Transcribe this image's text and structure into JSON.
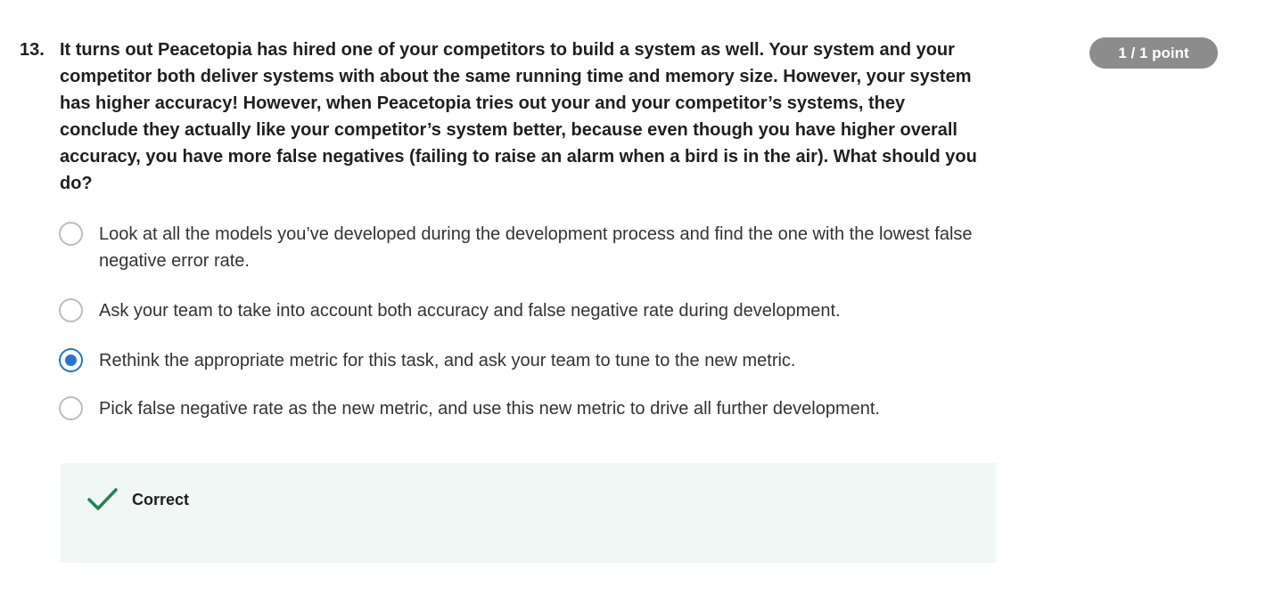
{
  "question": {
    "number": "13.",
    "text": "It turns out Peacetopia has hired one of your competitors to build a system as well. Your system and your competitor both deliver systems with about the same running time and memory size. However, your system has higher accuracy! However, when Peacetopia tries out your and your competitor’s systems, they conclude they actually like your competitor’s system better, because even though you have higher overall accuracy, you have more false negatives (failing to raise an alarm when a bird is in the air). What should you do?",
    "points": "1 / 1 point"
  },
  "options": [
    {
      "label": "Look at all the models you’ve developed during the development process and find the one with the lowest false negative error rate.",
      "selected": false
    },
    {
      "label": "Ask your team to take into account both accuracy and false negative rate during development.",
      "selected": false
    },
    {
      "label": "Rethink the appropriate metric for this task, and ask your team to tune to the new metric.",
      "selected": true
    },
    {
      "label": "Pick false negative rate as the new metric, and use this new metric to drive all further development.",
      "selected": false
    }
  ],
  "feedback": {
    "label": "Correct",
    "icon": "checkmark-icon"
  },
  "colors": {
    "accent": "#2a73cc",
    "badge": "#8c8c8c",
    "success": "#1f8354",
    "feedback_bg": "#f1f7f5"
  }
}
